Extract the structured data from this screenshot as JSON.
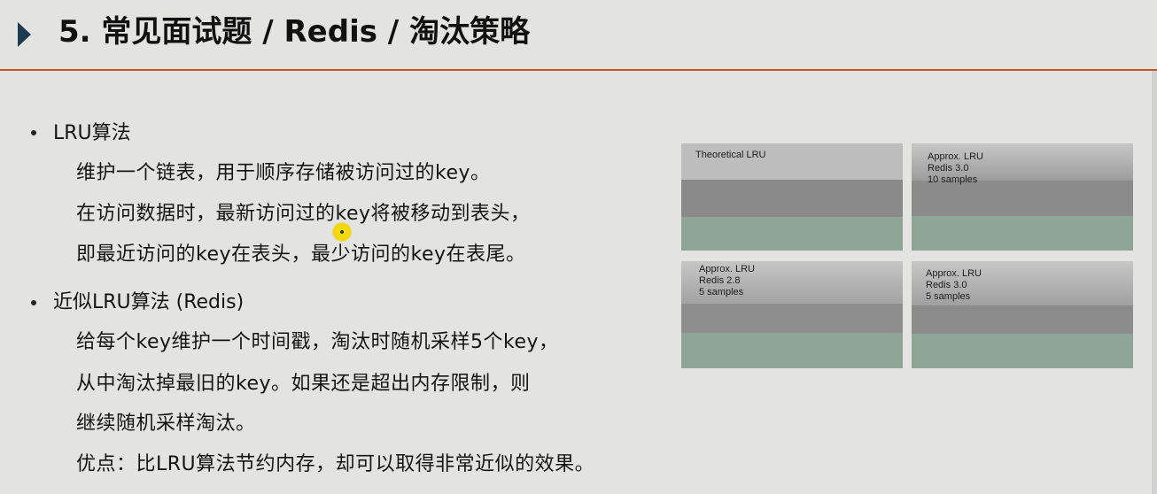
{
  "header": {
    "title": "5. 常见面试题 / Redis / 淘汰策略",
    "accent_color": "#c8532d",
    "marker_icon": "triangle-right-icon"
  },
  "bullets": [
    {
      "heading": "LRU算法",
      "lines": [
        "维护一个链表，用于顺序存储被访问过的key。",
        "在访问数据时，最新访问过的key将被移动到表头，",
        "即最近访问的key在表头，最少访问的key在表尾。"
      ]
    },
    {
      "heading": "近似LRU算法 (Redis)",
      "lines": [
        "给每个key维护一个时间戳，淘汰时随机采样5个key，",
        "从中淘汰掉最旧的key。如果还是超出内存限制，则",
        "继续随机采样淘汰。",
        "优点：比LRU算法节约内存，却可以取得非常近似的效果。"
      ]
    }
  ],
  "figure": {
    "panels": [
      {
        "label": "Theoretical LRU"
      },
      {
        "label": "Approx. LRU\nRedis 3.0\n10 samples"
      },
      {
        "label": "Approx. LRU\nRedis 2.8\n5 samples"
      },
      {
        "label": "Approx. LRU\nRedis 3.0\n5 samples"
      }
    ],
    "colors": {
      "evicted": "#bdbdbd",
      "old_keys": "#8c8c8c",
      "new_keys": "#8fa597"
    }
  }
}
